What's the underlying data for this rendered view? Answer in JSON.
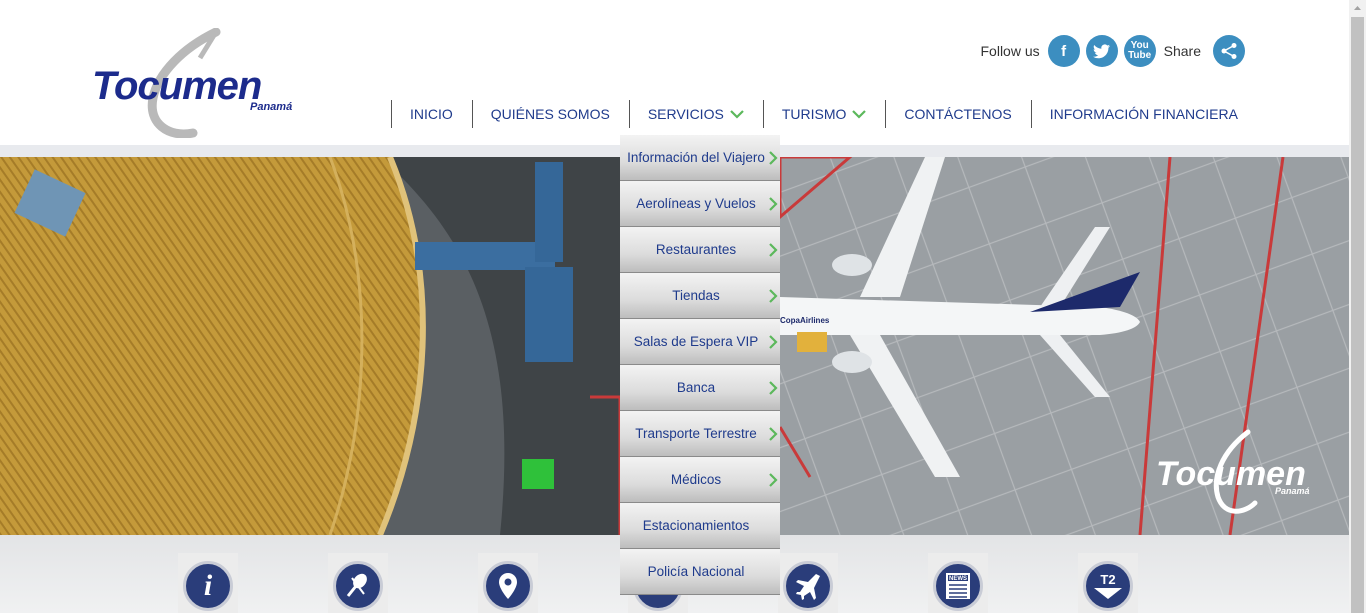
{
  "logo": {
    "word": "Tocumen",
    "sub": "Panamá"
  },
  "social": {
    "follow_label": "Follow us",
    "share_label": "Share",
    "icons": [
      "facebook-icon",
      "twitter-icon",
      "youtube-icon",
      "share-icon"
    ]
  },
  "nav": {
    "items": [
      {
        "label": "INICIO"
      },
      {
        "label": "QUIÉNES SOMOS"
      },
      {
        "label": "SERVICIOS",
        "has_submenu": true
      },
      {
        "label": "TURISMO",
        "has_submenu": true
      },
      {
        "label": "CONTÁCTENOS"
      },
      {
        "label": "INFORMACIÓN FINANCIERA"
      }
    ]
  },
  "dropdown": {
    "items": [
      {
        "label": "Información del Viajero",
        "has_submenu": true
      },
      {
        "label": "Aerolíneas y Vuelos",
        "has_submenu": true
      },
      {
        "label": "Restaurantes",
        "has_submenu": true
      },
      {
        "label": "Tiendas",
        "has_submenu": true
      },
      {
        "label": "Salas de Espera VIP",
        "has_submenu": true
      },
      {
        "label": "Banca",
        "has_submenu": true
      },
      {
        "label": "Transporte Terrestre",
        "has_submenu": true
      },
      {
        "label": "Médicos",
        "has_submenu": true
      },
      {
        "label": "Estacionamientos",
        "has_submenu": false
      },
      {
        "label": "Policía Nacional",
        "has_submenu": false
      }
    ]
  },
  "hero": {
    "watermark_word": "Tocumen",
    "watermark_sub": "Panamá",
    "aircraft_livery": "CopaAirlines"
  },
  "quick_links": {
    "items": [
      {
        "icon": "info-icon"
      },
      {
        "icon": "restaurant-icon"
      },
      {
        "icon": "location-pin-icon"
      },
      {
        "icon": "car-icon"
      },
      {
        "icon": "airplane-icon"
      },
      {
        "icon": "news-icon",
        "badge": "NEWS"
      },
      {
        "icon": "terminal-2-icon",
        "badge": "T2"
      }
    ]
  },
  "colors": {
    "nav_text": "#1f3b8c",
    "logo_blue": "#1c2b8c",
    "social_blue": "#3c8ec0",
    "chevron_green": "#5cb85c",
    "quick_icon_bg": "#2a3d7a"
  }
}
